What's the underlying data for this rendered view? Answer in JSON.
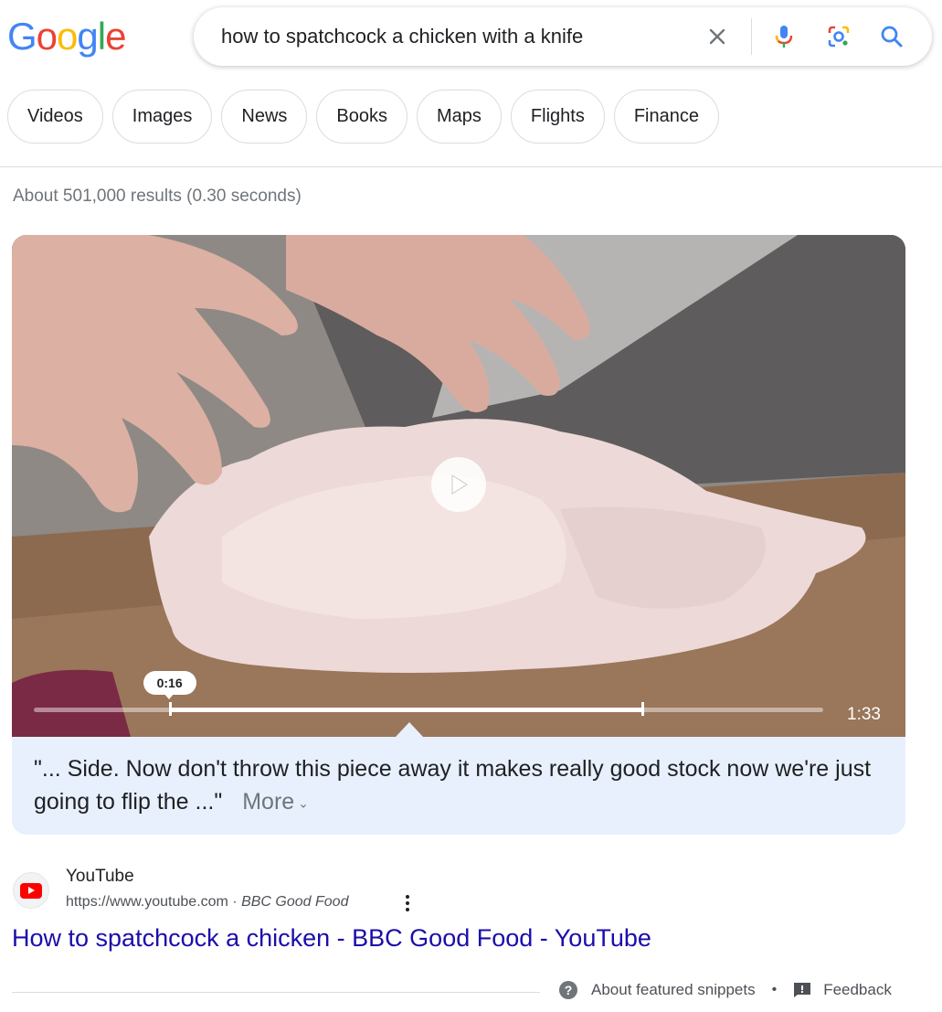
{
  "logo": {
    "letters": [
      {
        "ch": "G",
        "color": "#4285F4"
      },
      {
        "ch": "o",
        "color": "#EA4335"
      },
      {
        "ch": "o",
        "color": "#FBBC05"
      },
      {
        "ch": "g",
        "color": "#4285F4"
      },
      {
        "ch": "l",
        "color": "#34A853"
      },
      {
        "ch": "e",
        "color": "#EA4335"
      }
    ]
  },
  "search": {
    "query": "how to spatchcock a chicken with a knife",
    "icons": {
      "clear": "close-icon",
      "mic": "mic-icon",
      "lens": "lens-icon",
      "search": "search-icon"
    }
  },
  "chips": [
    "Videos",
    "Images",
    "News",
    "Books",
    "Maps",
    "Flights",
    "Finance"
  ],
  "stats": "About 501,000 results (0.30 seconds)",
  "video": {
    "current_time": "0:16",
    "duration": "1:33",
    "progress_start_fraction": 0.172,
    "progress_end_fraction": 0.772
  },
  "snippet": {
    "quote": "\"... Side. Now don't throw this piece away it makes really good stock now we're just going to flip the ...\"",
    "more_label": "More"
  },
  "source": {
    "site_name": "YouTube",
    "url": "https://www.youtube.com",
    "separator": " · ",
    "channel": "BBC Good Food"
  },
  "result_title": "How to spatchcock a chicken - BBC Good Food - YouTube",
  "footer": {
    "about_label": "About featured snippets",
    "separator": "•",
    "feedback_label": "Feedback"
  },
  "colors": {
    "link": "#1a0dab",
    "snippet_bg": "#e8f0fe",
    "youtube_red": "#ff0000"
  }
}
